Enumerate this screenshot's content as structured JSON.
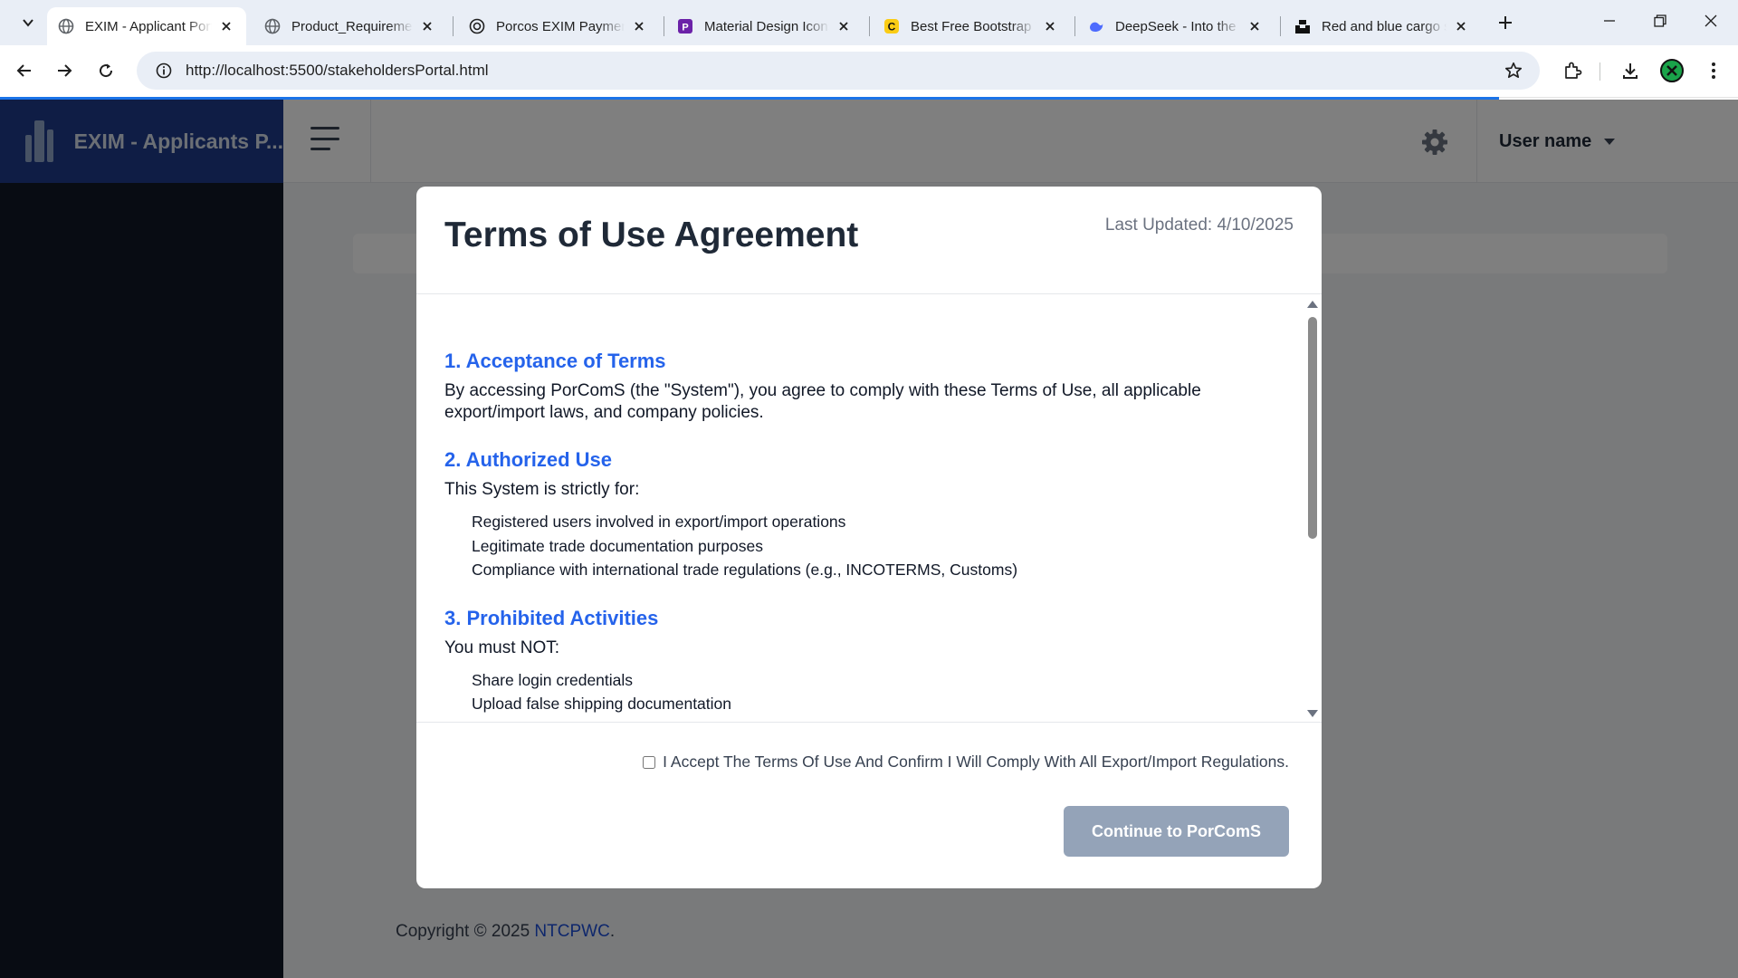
{
  "browser": {
    "tabs": [
      {
        "title": "EXIM - Applicant Portal",
        "active": true,
        "favicon": "globe-icon"
      },
      {
        "title": "Product_Requirements",
        "active": false,
        "favicon": "globe-icon"
      },
      {
        "title": "Porcos EXIM Payment",
        "active": false,
        "favicon": "openai-icon"
      },
      {
        "title": "Material Design Icons",
        "active": false,
        "favicon": "pictogrammers-icon"
      },
      {
        "title": "Best Free Bootstrap Templates",
        "active": false,
        "favicon": "c-icon"
      },
      {
        "title": "DeepSeek - Into the Unknown",
        "active": false,
        "favicon": "deepseek-icon"
      },
      {
        "title": "Red and blue cargo ship",
        "active": false,
        "favicon": "unsplash-icon"
      }
    ],
    "url": "http://localhost:5500/stakeholdersPortal.html",
    "colors": {
      "tabstrip": "#e9eef6",
      "loading_bar": "#1a73e8"
    }
  },
  "app": {
    "brand": "EXIM - Applicants P...",
    "user_name": "User name",
    "footer": {
      "prefix": "Copyright © 2025 ",
      "link": "NTCPWC",
      "suffix": "."
    }
  },
  "modal": {
    "title": "Terms of Use Agreement",
    "last_updated": "Last Updated: 4/10/2025",
    "sections": [
      {
        "heading": "1. Acceptance of Terms",
        "text": "By accessing PorComS (the \"System\"), you agree to comply with these Terms of Use, all applicable export/import laws, and company policies.",
        "items": []
      },
      {
        "heading": "2. Authorized Use",
        "text": "This System is strictly for:",
        "items": [
          "Registered users involved in export/import operations",
          "Legitimate trade documentation purposes",
          "Compliance with international trade regulations (e.g., INCOTERMS, Customs)"
        ]
      },
      {
        "heading": "3. Prohibited Activities",
        "text": "You must NOT:",
        "items": [
          "Share login credentials",
          "Upload false shipping documentation"
        ]
      }
    ],
    "accept_label": "I Accept The Terms Of Use And Confirm I Will Comply With All Export/Import Regulations.",
    "accept_checked": false,
    "continue_label": "Continue to PorComS",
    "colors": {
      "heading": "#2563eb",
      "button_disabled": "#94a3b8"
    }
  }
}
